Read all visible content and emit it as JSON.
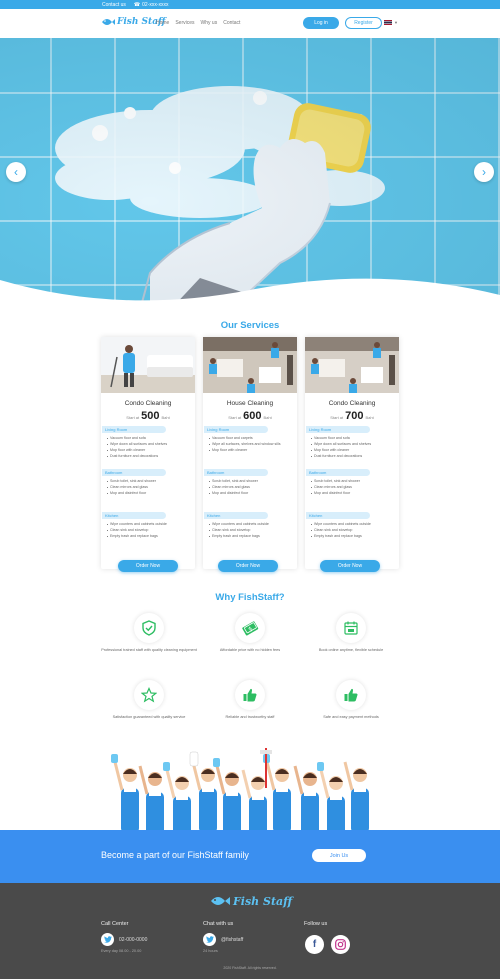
{
  "topbar": {
    "contact_label": "Contact us",
    "phone": "02-xxx-xxxx"
  },
  "header": {
    "brand": "Fish Staff",
    "nav": [
      "Home",
      "Services",
      "Why us",
      "Contact"
    ],
    "login_label": "Log in",
    "register_label": "Register",
    "language": "TH"
  },
  "hero": {
    "prev_icon": "chevron-left-icon",
    "next_icon": "chevron-right-icon"
  },
  "services": {
    "title": "Our Services",
    "cards": [
      {
        "title": "Condo Cleaning",
        "price_prefix": "Start at",
        "price": "500",
        "unit": "Baht",
        "order_label": "Order Now",
        "sections": [
          {
            "name": "Living Room",
            "items": [
              "Vacuum floor and sofa",
              "Wipe down all surfaces and shelves",
              "Mop floor with cleaner",
              "Dust furniture and decorations"
            ]
          },
          {
            "name": "Bathroom",
            "items": [
              "Scrub toilet, sink and shower",
              "Clean mirrors and glass",
              "Mop and disinfect floor"
            ]
          },
          {
            "name": "Kitchen",
            "items": [
              "Wipe counters and cabinets outside",
              "Clean sink and stovetop",
              "Empty trash and replace bags"
            ]
          }
        ]
      },
      {
        "title": "House Cleaning",
        "price_prefix": "Start at",
        "price": "600",
        "unit": "Baht",
        "order_label": "Order Now",
        "sections": [
          {
            "name": "Living Room",
            "items": [
              "Vacuum floor and carpets",
              "Wipe all surfaces, shelves and window sills",
              "Mop floor with cleaner"
            ]
          },
          {
            "name": "Bathroom",
            "items": [
              "Scrub toilet, sink and shower",
              "Clean mirrors and glass",
              "Mop and disinfect floor"
            ]
          },
          {
            "name": "Kitchen",
            "items": [
              "Wipe counters and cabinets outside",
              "Clean sink and stovetop",
              "Empty trash and replace bags"
            ]
          }
        ]
      },
      {
        "title": "Condo Cleaning",
        "price_prefix": "Start at",
        "price": "700",
        "unit": "Baht",
        "order_label": "Order Now",
        "sections": [
          {
            "name": "Living Room",
            "items": [
              "Vacuum floor and sofa",
              "Wipe down all surfaces and shelves",
              "Mop floor with cleaner",
              "Dust furniture and decorations"
            ]
          },
          {
            "name": "Bathroom",
            "items": [
              "Scrub toilet, sink and shower",
              "Clean mirrors and glass",
              "Mop and disinfect floor"
            ]
          },
          {
            "name": "Kitchen",
            "items": [
              "Wipe counters and cabinets outside",
              "Clean sink and stovetop",
              "Empty trash and replace bags"
            ]
          }
        ]
      }
    ]
  },
  "why": {
    "title": "Why FishStaff?",
    "features": [
      {
        "icon": "shield-check-icon",
        "text": "Professional trained staff with quality cleaning equipment"
      },
      {
        "icon": "money-icon",
        "text": "Affordable price with no hidden fees"
      },
      {
        "icon": "calendar-icon",
        "text": "Book online anytime, flexible schedule"
      },
      {
        "icon": "star-icon",
        "text": "Satisfaction guaranteed with quality service"
      },
      {
        "icon": "thumbs-up-icon",
        "text": "Reliable and trustworthy staff"
      },
      {
        "icon": "thumbs-up-icon",
        "text": "Safe and easy payment methods"
      }
    ]
  },
  "join": {
    "text": "Become a part of our FishStaff family",
    "button_label": "Join Us"
  },
  "footer": {
    "brand": "Fish Staff",
    "call_title": "Call Center",
    "phone": "02-000-0000",
    "call_hours": "Every day 08.00 - 20.00",
    "chat_title": "Chat with us",
    "chat_id": "@fishstaff",
    "chat_hours": "24 hours",
    "follow_title": "Follow us",
    "copyright": "2020 FishStaff. All rights reserved."
  },
  "colors": {
    "accent": "#3aa9e8",
    "banner": "#3a8ff0",
    "footer": "#4a4a4a"
  }
}
